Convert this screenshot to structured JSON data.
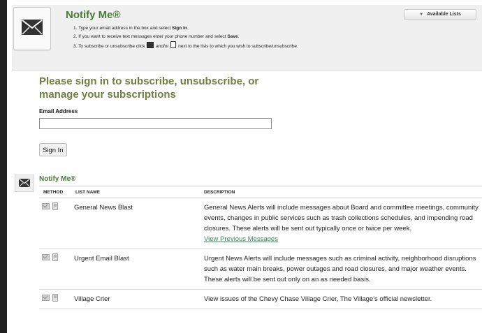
{
  "colors": {
    "title_green": "#4a7a3a",
    "heading_olive": "#6e7f3f",
    "link_green": "#3a8a5c",
    "header_bg": "#f0f0f0"
  },
  "header": {
    "title": "Notify Me®",
    "icon": "envelope-icon",
    "steps": [
      {
        "text": "1. Type your email address in the box and select ",
        "bold": "Sign In",
        "suffix": "."
      },
      {
        "text": "2. If you want to receive text messages enter your phone number and select ",
        "bold": "Save",
        "suffix": "."
      },
      {
        "text": "3. To subscribe or unsubscribe click ",
        "middle": " and/or ",
        "suffix": " next to the lists to which you wish to subscribe/unsubscribe."
      }
    ],
    "available_lists_label": "Available Lists"
  },
  "signin": {
    "heading": "Please sign in to subscribe, unsubscribe, or manage your subscriptions",
    "email_label": "Email Address",
    "email_value": "",
    "button_label": "Sign In"
  },
  "lists_section": {
    "title": "Notify Me®",
    "icon": "envelope-icon",
    "columns": [
      "METHOD",
      "LIST NAME",
      "DESCRIPTION"
    ],
    "rows": [
      {
        "name": "General News Blast",
        "description": "General News Alerts will include messages about Board and committee meetings, community events, changes in public services such as trash collections schedules, and impending road closures. These alerts will be sent out typically once or twice per week.",
        "link": "View Previous Messages"
      },
      {
        "name": "Urgent Email Blast",
        "description": "Urgent News Alerts will include messages such as criminal activity, neighborhood disruptions such as water main breaks, power outages and road closures, and major weather events. These alerts will be sent out only on an as needed basis."
      },
      {
        "name": "Village Crier",
        "description": "View issues of the Chevy Chase Village Crier, The Village's official newsletter."
      }
    ]
  }
}
